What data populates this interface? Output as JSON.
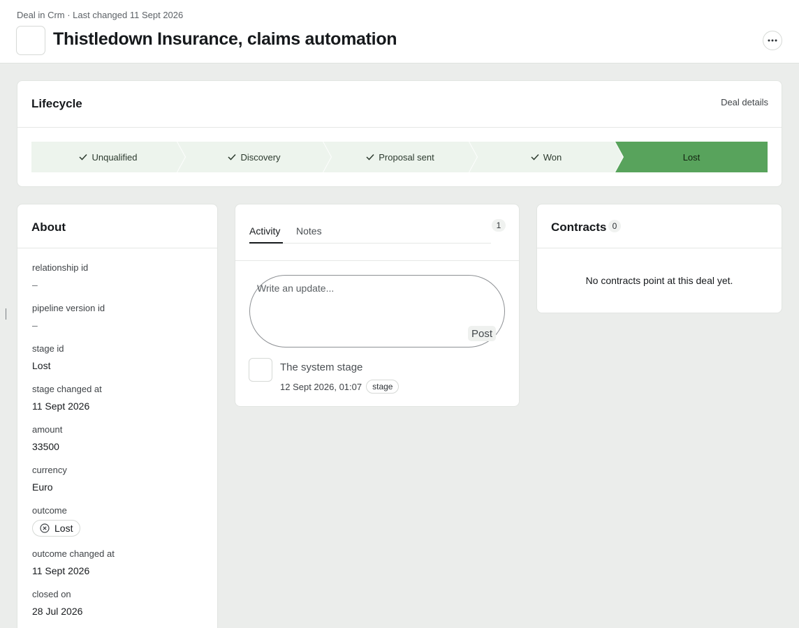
{
  "header": {
    "breadcrumb": "Deal in Crm · Last changed 11 Sept 2026",
    "title": "Thistledown Insurance, claims automation",
    "more_icon": "more-horizontal-icon"
  },
  "lifecycle": {
    "title": "Lifecycle",
    "details_link": "Deal details",
    "stages": [
      {
        "label": "Unqualified",
        "state": "done"
      },
      {
        "label": "Discovery",
        "state": "done"
      },
      {
        "label": "Proposal sent",
        "state": "done"
      },
      {
        "label": "Won",
        "state": "done"
      },
      {
        "label": "Lost",
        "state": "current"
      }
    ],
    "colors": {
      "done": "#edf4ed",
      "current": "#58a35c"
    }
  },
  "about": {
    "title": "About",
    "fields": [
      {
        "label": "relationship id",
        "value": "–"
      },
      {
        "label": "pipeline version id",
        "value": "–"
      },
      {
        "label": "stage id",
        "value": "Lost"
      },
      {
        "label": "stage changed at",
        "value": "11 Sept 2026"
      },
      {
        "label": "amount",
        "value": "33500"
      },
      {
        "label": "currency",
        "value": "Euro"
      },
      {
        "label": "outcome",
        "value": "Lost"
      },
      {
        "label": "outcome changed at",
        "value": "11 Sept 2026"
      },
      {
        "label": "closed on",
        "value": "28 Jul 2026"
      }
    ]
  },
  "activity": {
    "tabs": [
      {
        "label": "Activity",
        "active": true
      },
      {
        "label": "Notes",
        "active": false
      }
    ],
    "count": "1",
    "composer": {
      "placeholder": "Write an update...",
      "value": "",
      "post_label": "Post"
    },
    "events": [
      {
        "title": "The system stage",
        "timestamp": "12 Sept 2026, 01:07",
        "tag": "stage"
      }
    ]
  },
  "contracts": {
    "title": "Contracts",
    "count": "0",
    "empty_message": "No contracts point at this deal yet."
  }
}
